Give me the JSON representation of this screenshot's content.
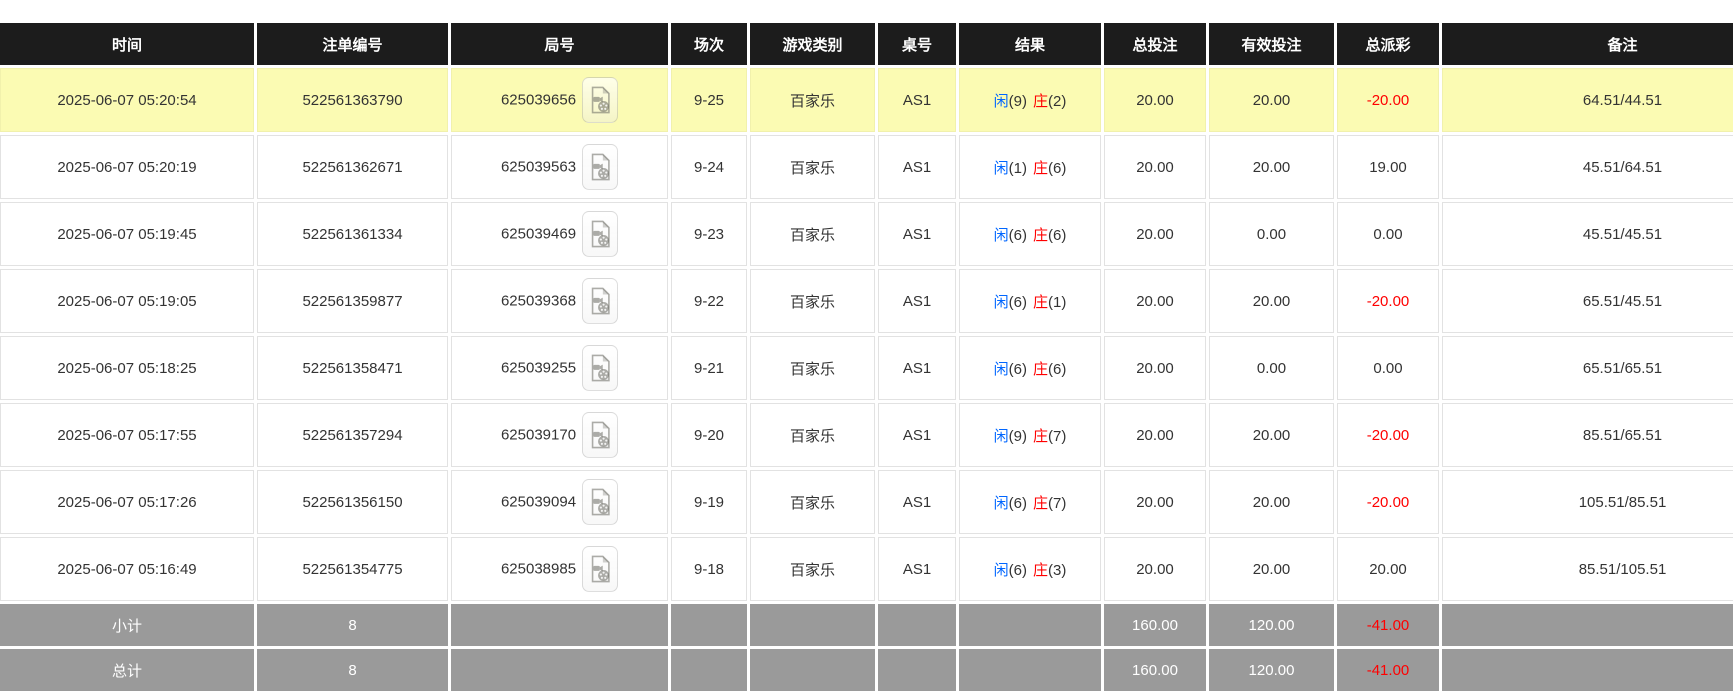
{
  "columns": [
    "时间",
    "注单编号",
    "局号",
    "场次",
    "游戏类别",
    "桌号",
    "结果",
    "总投注",
    "有效投注",
    "总派彩",
    "备注"
  ],
  "rows": [
    {
      "time": "2025-06-07 05:20:54",
      "bet_id": "522561363790",
      "round_id": "625039656",
      "session": "9-25",
      "game_type": "百家乐",
      "table_no": "AS1",
      "result_player": "闲",
      "result_player_score": "(9)",
      "result_banker": "庄",
      "result_banker_score": "(2)",
      "total_bet": "20.00",
      "valid_bet": "20.00",
      "payout": "-20.00",
      "remark": "64.51/44.51",
      "highlighted": true
    },
    {
      "time": "2025-06-07 05:20:19",
      "bet_id": "522561362671",
      "round_id": "625039563",
      "session": "9-24",
      "game_type": "百家乐",
      "table_no": "AS1",
      "result_player": "闲",
      "result_player_score": "(1)",
      "result_banker": "庄",
      "result_banker_score": "(6)",
      "total_bet": "20.00",
      "valid_bet": "20.00",
      "payout": "19.00",
      "remark": "45.51/64.51",
      "highlighted": false
    },
    {
      "time": "2025-06-07 05:19:45",
      "bet_id": "522561361334",
      "round_id": "625039469",
      "session": "9-23",
      "game_type": "百家乐",
      "table_no": "AS1",
      "result_player": "闲",
      "result_player_score": "(6)",
      "result_banker": "庄",
      "result_banker_score": "(6)",
      "total_bet": "20.00",
      "valid_bet": "0.00",
      "payout": "0.00",
      "remark": "45.51/45.51",
      "highlighted": false
    },
    {
      "time": "2025-06-07 05:19:05",
      "bet_id": "522561359877",
      "round_id": "625039368",
      "session": "9-22",
      "game_type": "百家乐",
      "table_no": "AS1",
      "result_player": "闲",
      "result_player_score": "(6)",
      "result_banker": "庄",
      "result_banker_score": "(1)",
      "total_bet": "20.00",
      "valid_bet": "20.00",
      "payout": "-20.00",
      "remark": "65.51/45.51",
      "highlighted": false
    },
    {
      "time": "2025-06-07 05:18:25",
      "bet_id": "522561358471",
      "round_id": "625039255",
      "session": "9-21",
      "game_type": "百家乐",
      "table_no": "AS1",
      "result_player": "闲",
      "result_player_score": "(6)",
      "result_banker": "庄",
      "result_banker_score": "(6)",
      "total_bet": "20.00",
      "valid_bet": "0.00",
      "payout": "0.00",
      "remark": "65.51/65.51",
      "highlighted": false
    },
    {
      "time": "2025-06-07 05:17:55",
      "bet_id": "522561357294",
      "round_id": "625039170",
      "session": "9-20",
      "game_type": "百家乐",
      "table_no": "AS1",
      "result_player": "闲",
      "result_player_score": "(9)",
      "result_banker": "庄",
      "result_banker_score": "(7)",
      "total_bet": "20.00",
      "valid_bet": "20.00",
      "payout": "-20.00",
      "remark": "85.51/65.51",
      "highlighted": false
    },
    {
      "time": "2025-06-07 05:17:26",
      "bet_id": "522561356150",
      "round_id": "625039094",
      "session": "9-19",
      "game_type": "百家乐",
      "table_no": "AS1",
      "result_player": "闲",
      "result_player_score": "(6)",
      "result_banker": "庄",
      "result_banker_score": "(7)",
      "total_bet": "20.00",
      "valid_bet": "20.00",
      "payout": "-20.00",
      "remark": "105.51/85.51",
      "highlighted": false
    },
    {
      "time": "2025-06-07 05:16:49",
      "bet_id": "522561354775",
      "round_id": "625038985",
      "session": "9-18",
      "game_type": "百家乐",
      "table_no": "AS1",
      "result_player": "闲",
      "result_player_score": "(6)",
      "result_banker": "庄",
      "result_banker_score": "(3)",
      "total_bet": "20.00",
      "valid_bet": "20.00",
      "payout": "20.00",
      "remark": "85.51/105.51",
      "highlighted": false
    }
  ],
  "summary": [
    {
      "label": "小计",
      "count": "8",
      "total_bet": "160.00",
      "valid_bet": "120.00",
      "payout": "-41.00",
      "remark": ""
    },
    {
      "label": "总计",
      "count": "8",
      "total_bet": "160.00",
      "valid_bet": "120.00",
      "payout": "-41.00",
      "remark": ""
    }
  ],
  "colors": {
    "highlight_row": "#fbfbb3",
    "header_bg": "#1c1c1c",
    "summary_bg": "#9a9a9a",
    "bet_blue": "#0066ff",
    "loss_red": "#ff0000"
  },
  "icons": {
    "video": "video-replay-icon"
  }
}
